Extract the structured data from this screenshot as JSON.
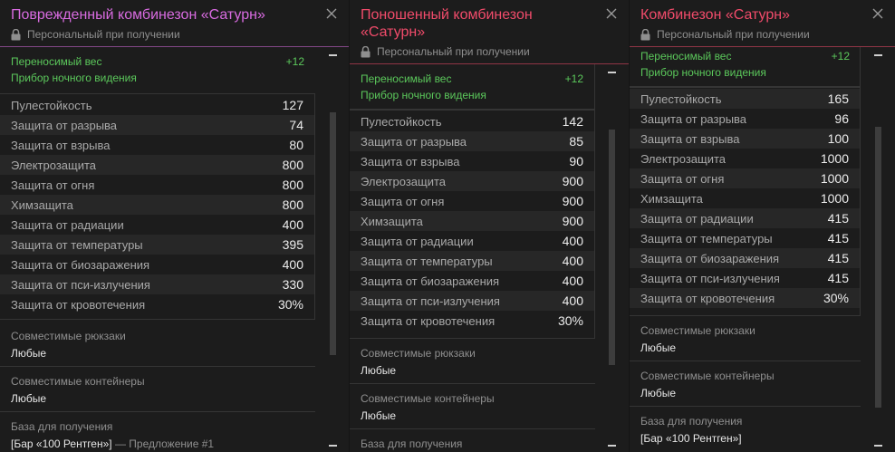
{
  "colors": {
    "damaged_title": "#d86be0",
    "worn_title": "#f04b6a",
    "normal_title": "#f04b6a",
    "bonus_green": "#5bc85b"
  },
  "icons": {
    "close": "close-icon",
    "lock": "lock-icon",
    "scroll_minus": "minus-icon"
  },
  "panels": [
    {
      "title": "Поврежденный комбинезон «Сатурн»",
      "binding": "Персональный при получении",
      "bonuses": [
        {
          "label": "Переносимый вес",
          "value": "+12"
        },
        {
          "label": "Прибор ночного видения",
          "value": ""
        }
      ],
      "stats": [
        {
          "label": "Пулестойкость",
          "value": "127"
        },
        {
          "label": "Защита от разрыва",
          "value": "74"
        },
        {
          "label": "Защита от взрыва",
          "value": "80"
        },
        {
          "label": "Электрозащита",
          "value": "800"
        },
        {
          "label": "Защита от огня",
          "value": "800"
        },
        {
          "label": "Химзащита",
          "value": "800"
        },
        {
          "label": "Защита от радиации",
          "value": "400"
        },
        {
          "label": "Защита от температуры",
          "value": "395"
        },
        {
          "label": "Защита от биозаражения",
          "value": "400"
        },
        {
          "label": "Защита от пси-излучения",
          "value": "330"
        },
        {
          "label": "Защита от кровотечения",
          "value": "30%"
        }
      ],
      "backpacks_header": "Совместимые рюкзаки",
      "backpacks_value": "Любые",
      "containers_header": "Совместимые контейнеры",
      "containers_value": "Любые",
      "base_header": "База для получения",
      "base_value": "[Бар «100 Рентген»]",
      "base_suffix": " — Предложение #1"
    },
    {
      "title": "Поношенный комбинезон «Сатурн»",
      "binding": "Персональный при получении",
      "bonuses": [
        {
          "label": "Переносимый вес",
          "value": "+12"
        },
        {
          "label": "Прибор ночного видения",
          "value": ""
        }
      ],
      "stats": [
        {
          "label": "Пулестойкость",
          "value": "142"
        },
        {
          "label": "Защита от разрыва",
          "value": "85"
        },
        {
          "label": "Защита от взрыва",
          "value": "90"
        },
        {
          "label": "Электрозащита",
          "value": "900"
        },
        {
          "label": "Защита от огня",
          "value": "900"
        },
        {
          "label": "Химзащита",
          "value": "900"
        },
        {
          "label": "Защита от радиации",
          "value": "400"
        },
        {
          "label": "Защита от температуры",
          "value": "400"
        },
        {
          "label": "Защита от биозаражения",
          "value": "400"
        },
        {
          "label": "Защита от пси-излучения",
          "value": "400"
        },
        {
          "label": "Защита от кровотечения",
          "value": "30%"
        }
      ],
      "backpacks_header": "Совместимые рюкзаки",
      "backpacks_value": "Любые",
      "containers_header": "Совместимые контейнеры",
      "containers_value": "Любые",
      "base_header": "База для получения",
      "base_value": "",
      "base_suffix": ""
    },
    {
      "title": "Комбинезон «Сатурн»",
      "binding": "Персональный при получении",
      "bonuses": [
        {
          "label": "Переносимый вес",
          "value": "+12"
        },
        {
          "label": "Прибор ночного видения",
          "value": ""
        }
      ],
      "stats": [
        {
          "label": "Пулестойкость",
          "value": "165"
        },
        {
          "label": "Защита от разрыва",
          "value": "96"
        },
        {
          "label": "Защита от взрыва",
          "value": "100"
        },
        {
          "label": "Электрозащита",
          "value": "1000"
        },
        {
          "label": "Защита от огня",
          "value": "1000"
        },
        {
          "label": "Химзащита",
          "value": "1000"
        },
        {
          "label": "Защита от радиации",
          "value": "415"
        },
        {
          "label": "Защита от температуры",
          "value": "415"
        },
        {
          "label": "Защита от биозаражения",
          "value": "415"
        },
        {
          "label": "Защита от пси-излучения",
          "value": "415"
        },
        {
          "label": "Защита от кровотечения",
          "value": "30%"
        }
      ],
      "backpacks_header": "Совместимые рюкзаки",
      "backpacks_value": "Любые",
      "containers_header": "Совместимые контейнеры",
      "containers_value": "Любые",
      "base_header": "База для получения",
      "base_value": "[Бар «100 Рентген»]",
      "base_suffix": ""
    }
  ]
}
